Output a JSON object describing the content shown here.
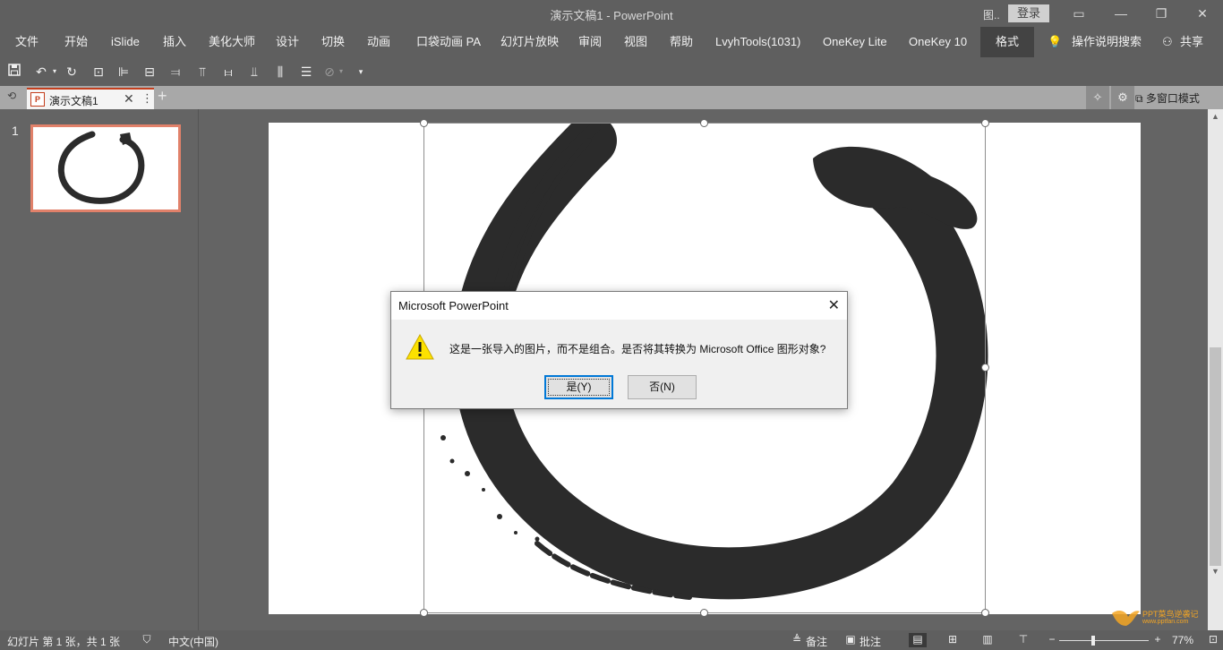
{
  "window": {
    "title": "演示文稿1  -  PowerPoint",
    "left_icon": "图..",
    "login": "登录"
  },
  "ribbon": {
    "tabs": [
      "文件",
      "开始",
      "iSlide",
      "插入",
      "美化大师",
      "设计",
      "切换",
      "动画",
      "口袋动画 PA",
      "幻灯片放映",
      "审阅",
      "视图",
      "帮助",
      "LvyhTools(1031)",
      "OneKey Lite",
      "OneKey 10",
      "格式"
    ],
    "active_tab": "格式",
    "help_search": "操作说明搜索",
    "share": "共享"
  },
  "quick_access": {
    "icons": [
      "save-icon",
      "undo-icon",
      "redo-icon",
      "slideshow-icon",
      "align-left-icon",
      "align-center-icon",
      "align-right-icon",
      "align-top-icon",
      "align-middle-icon",
      "align-bottom-icon",
      "distribute-h-icon",
      "distribute-v-icon",
      "merge-shapes-icon",
      "customize-icon"
    ]
  },
  "doc_tabs": {
    "name": "演示文稿1",
    "multi_window": "多窗口模式"
  },
  "thumbnails": [
    {
      "number": "1"
    }
  ],
  "dialog": {
    "title": "Microsoft PowerPoint",
    "message": "这是一张导入的图片，而不是组合。是否将其转换为 Microsoft Office 图形对象?",
    "yes": "是(Y)",
    "no": "否(N)"
  },
  "status": {
    "slide_info": "幻灯片 第 1 张，共 1 张",
    "language": "中文(中国)",
    "notes": "备注",
    "comments": "批注",
    "zoom": "77%"
  },
  "watermark": {
    "line1": "PPT菜鸟逆袭记",
    "line2": "www.pptfan.com"
  },
  "colors": {
    "accent": "#c43e1c",
    "thumb_border": "#e1816a",
    "ink": "#2b2b2b"
  }
}
